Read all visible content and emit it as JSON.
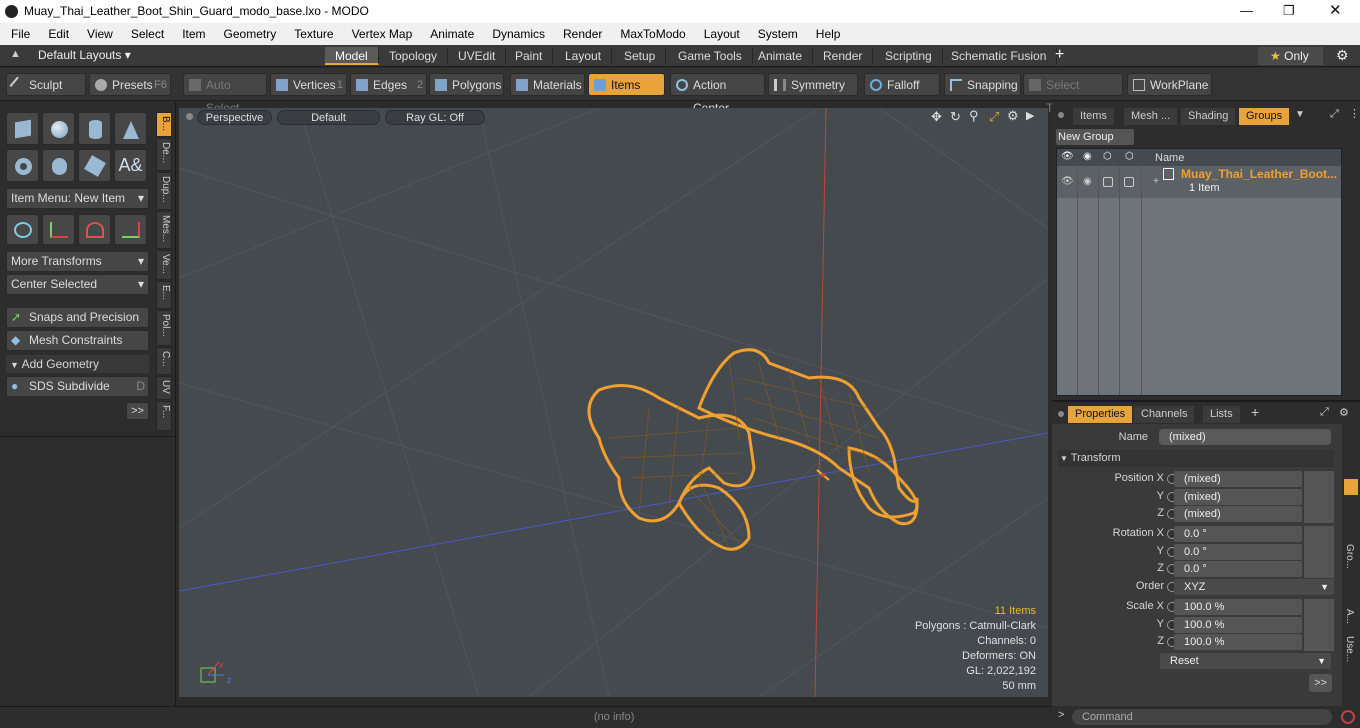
{
  "window": {
    "title": "Muay_Thai_Leather_Boot_Shin_Guard_modo_base.lxo - MODO"
  },
  "menu": [
    "File",
    "Edit",
    "View",
    "Select",
    "Item",
    "Geometry",
    "Texture",
    "Vertex Map",
    "Animate",
    "Dynamics",
    "Render",
    "MaxToModo",
    "Layout",
    "System",
    "Help"
  ],
  "layouts": {
    "label": "Default Layouts",
    "tabs": [
      "Model",
      "Topology",
      "UVEdit",
      "Paint",
      "Layout",
      "Setup",
      "Game Tools",
      "Animate",
      "Render",
      "Scripting",
      "Schematic Fusion"
    ],
    "active": "Model",
    "only_label": "Only"
  },
  "toolbar": {
    "sculpt": "Sculpt",
    "presets": "Presets",
    "presets_key": "F6",
    "auto_select": "Auto Select",
    "vertices": "Vertices",
    "vertices_num": "1",
    "edges": "Edges",
    "edges_num": "2",
    "polygons": "Polygons",
    "materials": "Materials",
    "items": "Items",
    "action_center": "Action Center",
    "symmetry": "Symmetry",
    "falloff": "Falloff",
    "snapping": "Snapping",
    "select_through": "Select Through",
    "workplane": "WorkPlane"
  },
  "left": {
    "item_menu": "Item Menu: New Item",
    "more_transforms": "More Transforms",
    "center_selected": "Center Selected",
    "snaps": "Snaps and Precision",
    "mesh_constraints": "Mesh Constraints",
    "add_geometry": "Add Geometry",
    "sds_subdivide": "SDS Subdivide",
    "sds_key": "D",
    "more": ">>",
    "side_tabs": [
      "B...",
      "De...",
      "Dup...",
      "Mes...",
      "Ve...",
      "E...",
      "Pol...",
      "C...",
      "UV",
      "F..."
    ]
  },
  "viewport": {
    "perspective": "Perspective",
    "default": "Default",
    "raygl": "Ray GL: Off",
    "info": {
      "items": "11 Items",
      "polygons": "Polygons : Catmull-Clark",
      "channels": "Channels: 0",
      "deformers": "Deformers: ON",
      "gl": "GL: 2,022,192",
      "unit": "50 mm"
    }
  },
  "groups": {
    "tabs": [
      "Items",
      "Mesh ...",
      "Shading",
      "Groups"
    ],
    "active": "Groups",
    "new_group": "New Group",
    "col_name": "Name",
    "row_name": "Muay_Thai_Leather_Boot...",
    "row_sub": "1 Item"
  },
  "properties": {
    "tabs": [
      "Properties",
      "Channels",
      "Lists"
    ],
    "name_label": "Name",
    "name_value": "(mixed)",
    "transform": "Transform",
    "position_label": "Position X",
    "pos": [
      "(mixed)",
      "(mixed)",
      "(mixed)"
    ],
    "rotation_label": "Rotation X",
    "rot": [
      "0.0 °",
      "0.0 °",
      "0.0 °"
    ],
    "order_label": "Order",
    "order_value": "XYZ",
    "scale_label": "Scale X",
    "scale": [
      "100.0 %",
      "100.0 %",
      "100.0 %"
    ],
    "y": "Y",
    "z": "Z",
    "reset": "Reset",
    "more": ">>",
    "side_tabs": [
      "Gro...",
      "A...",
      "Use..."
    ]
  },
  "status": {
    "info": "(no info)",
    "command": "Command"
  },
  "colors": {
    "accent": "#e8a33a",
    "wire": "#f0a030"
  }
}
